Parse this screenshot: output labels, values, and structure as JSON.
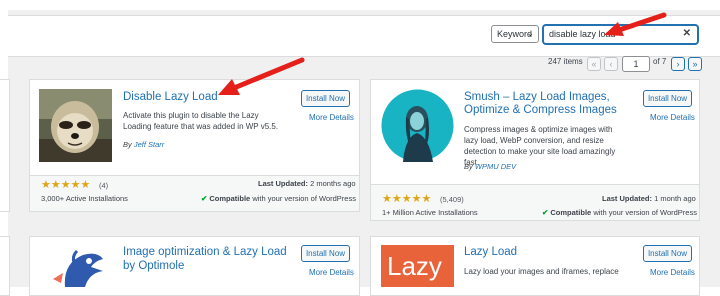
{
  "filter": {
    "type_select": "Keyword",
    "search_value": "disable lazy load"
  },
  "pagination": {
    "items": "247 items",
    "first": "«",
    "prev": "‹",
    "current_page": "1",
    "of": "of 7",
    "next": "›",
    "last": "»"
  },
  "plugins": [
    {
      "title": "Disable Lazy Load",
      "install": "Install Now",
      "more": "More Details",
      "description": "Activate this plugin to disable the Lazy Loading feature that was added in WP v5.5.",
      "by_label": "By",
      "author": "Jeff Starr",
      "rating_count": "(4)",
      "installs": "3,000+ Active Installations",
      "last_updated_label": "Last Updated:",
      "last_updated": "2 months ago",
      "compat_strong": "Compatible",
      "compat_rest": "with your version of WordPress"
    },
    {
      "title_line1": "Smush – Lazy Load Images,",
      "title_line2": "Optimize & Compress Images",
      "install": "Install Now",
      "more": "More Details",
      "description": "Compress images & optimize images with lazy load, WebP conversion, and resize detection to make your site load amazingly fast.",
      "by_label": "By",
      "author": "WPMU DEV",
      "rating_count": "(5,409)",
      "installs": "1+ Million Active Installations",
      "last_updated_label": "Last Updated:",
      "last_updated": "1 month ago",
      "compat_strong": "Compatible",
      "compat_rest": "with your version of WordPress"
    },
    {
      "title_line1": "Image optimization & Lazy Load",
      "title_line2": "by Optimole",
      "install": "Install Now",
      "more": "More Details"
    },
    {
      "title": "Lazy Load",
      "install": "Install Now",
      "more": "More Details",
      "description": "Lazy load your images and iframes, replace",
      "icon_text": "Lazy"
    }
  ],
  "stars": "★★★★★",
  "check": "✔",
  "colors": {
    "accent": "#2271b1",
    "arrow": "#e5201a",
    "star": "#dba617",
    "lazy_orange": "#e8623a"
  }
}
